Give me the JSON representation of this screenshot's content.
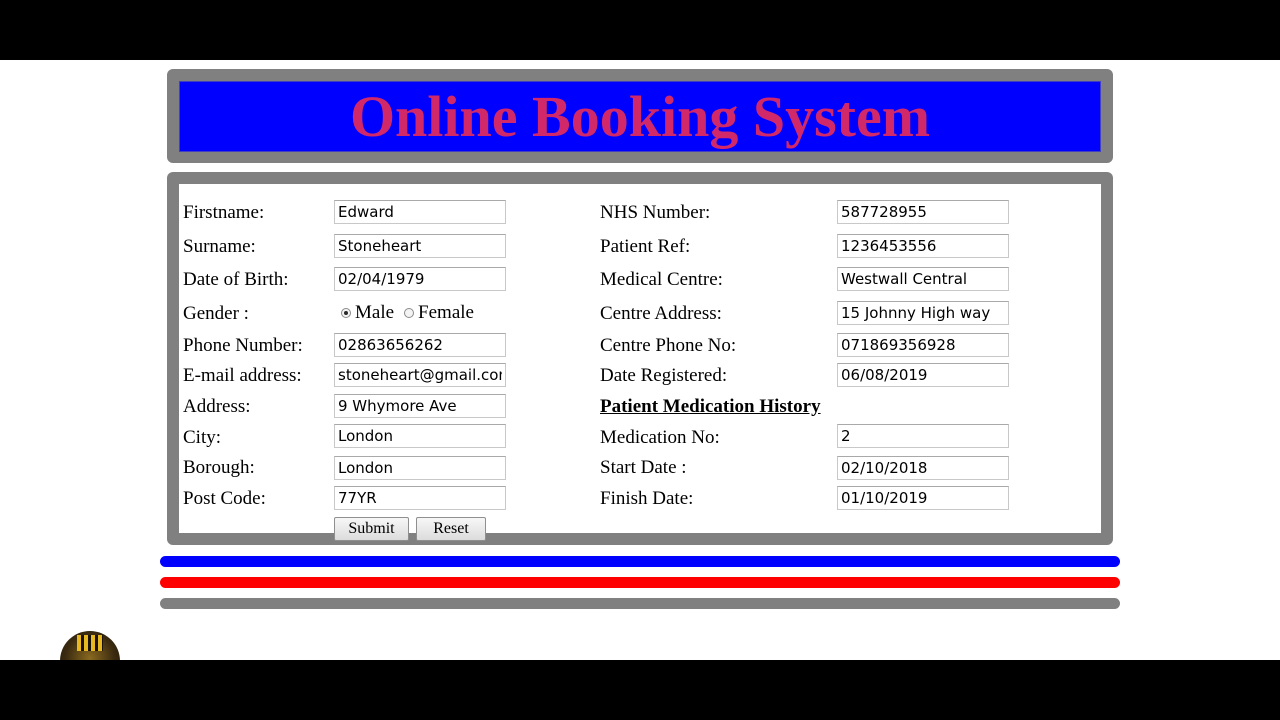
{
  "header": {
    "title": "Online Booking System"
  },
  "patient": {
    "firstname_label": "Firstname:",
    "firstname_value": "Edward",
    "surname_label": "Surname:",
    "surname_value": "Stoneheart",
    "dob_label": "Date of Birth:",
    "dob_value": "02/04/1979",
    "gender_label": "Gender :",
    "gender_options": [
      "Male",
      "Female"
    ],
    "gender_selected": "Male",
    "phone_label": "Phone Number:",
    "phone_value": "02863656262",
    "email_label": "E-mail address:",
    "email_value": "stoneheart@gmail.com",
    "address_label": "Address:",
    "address_value": "9 Whymore Ave",
    "city_label": "City:",
    "city_value": "London",
    "borough_label": "Borough:",
    "borough_value": "London",
    "postcode_label": "Post Code:",
    "postcode_value": "77YR"
  },
  "centre": {
    "nhs_label": "NHS Number:",
    "nhs_value": "587728955",
    "ref_label": "Patient Ref:",
    "ref_value": "1236453556",
    "centre_label": "Medical Centre:",
    "centre_value": "Westwall Central",
    "centre_address_label": "Centre Address:",
    "centre_address_value": "15 Johnny High way",
    "centre_phone_label": "Centre Phone No:",
    "centre_phone_value": "071869356928",
    "registered_label": "Date Registered:",
    "registered_value": "06/08/2019"
  },
  "medication": {
    "heading": "Patient Medication History",
    "number_label": "Medication No:",
    "number_value": "2",
    "start_label": "Start Date :",
    "start_value": "02/10/2018",
    "finish_label": "Finish Date:",
    "finish_value": "01/10/2019"
  },
  "actions": {
    "submit_label": "Submit",
    "reset_label": "Reset"
  },
  "colors": {
    "header_bg": "#0000ff",
    "title_color": "#d1286a",
    "frame": "#808080",
    "stripe_blue": "#0000ff",
    "stripe_red": "#ff0000",
    "stripe_gray": "#808080"
  },
  "icons": {
    "channel_logo": "channel-logo-icon"
  }
}
